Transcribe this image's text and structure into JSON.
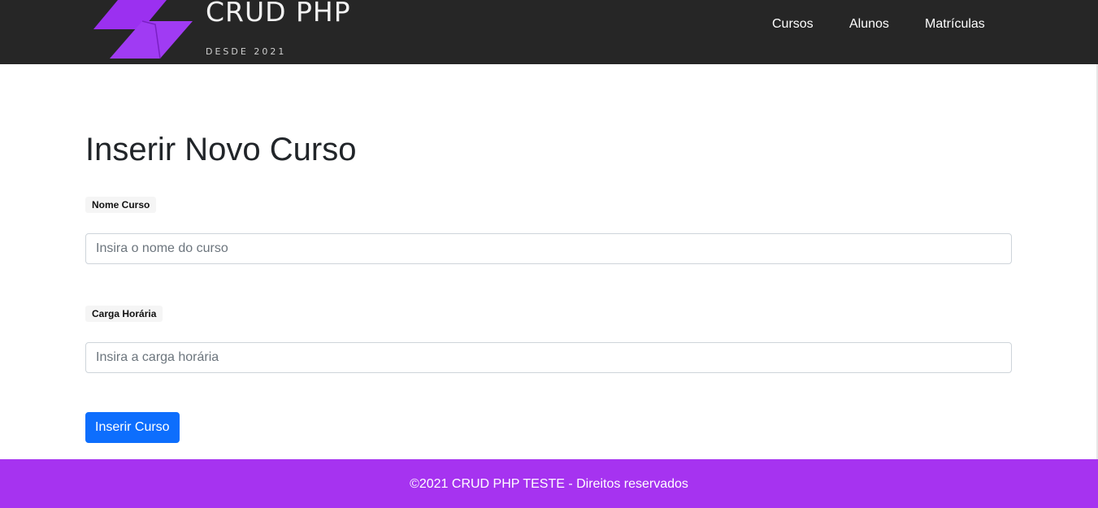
{
  "brand": {
    "title": "CRUD PHP",
    "subtitle": "DESDE 2021",
    "logo_icon": "purple-parallelogram-logo",
    "logo_color": "#9b30f0"
  },
  "nav": {
    "items": [
      {
        "label": "Cursos"
      },
      {
        "label": "Alunos"
      },
      {
        "label": "Matrículas"
      }
    ]
  },
  "main": {
    "title": "Inserir Novo Curso",
    "form": {
      "nome_label": "Nome Curso",
      "nome_value": "",
      "nome_placeholder": "Insira o nome do curso",
      "carga_label": "Carga Horária",
      "carga_value": "",
      "carga_placeholder": "Insira a carga horária",
      "submit_label": "Inserir Curso"
    }
  },
  "footer": {
    "text": "©2021 CRUD PHP TESTE - Direitos reservados"
  },
  "colors": {
    "header_bg": "#262626",
    "footer_bg": "#a633f0",
    "primary_button": "#0d6efd"
  }
}
